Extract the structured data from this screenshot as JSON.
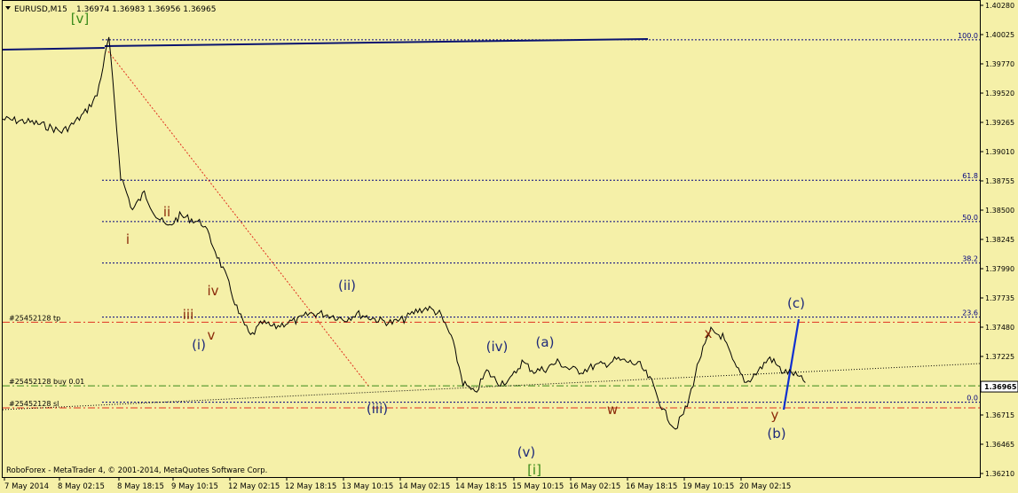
{
  "window": {
    "symbol_header": "EURUSD,M15",
    "ohlc": "1.36974 1.36983 1.36956 1.36965",
    "footer": "RoboForex - MetaTrader 4, © 2001-2014, MetaQuotes Software Corp."
  },
  "colors": {
    "background": "#F5F0A8",
    "price": "#000000",
    "fib": "#000080",
    "wave_navy": "#1F2A7A",
    "wave_red": "#8B2A0A",
    "wave_green": "#3A8A1A",
    "order_red": "#E03020",
    "order_green": "#3A8A1A",
    "trend_red": "#E03020"
  },
  "chart_data": {
    "type": "line",
    "title": "EURUSD,M15",
    "ylim": [
      1.3621,
      1.4028
    ],
    "current_price": "1.36965",
    "y_ticks": [
      "1.40280",
      "1.40025",
      "1.39770",
      "1.39520",
      "1.39265",
      "1.39010",
      "1.38755",
      "1.38500",
      "1.38245",
      "1.37990",
      "1.37735",
      "1.37480",
      "1.37225",
      "1.36965",
      "1.36715",
      "1.36465",
      "1.36210"
    ],
    "x_ticks": [
      "7 May 2014",
      "8 May 02:15",
      "8 May 18:15",
      "9 May 10:15",
      "12 May 02:15",
      "12 May 18:15",
      "13 May 10:15",
      "14 May 02:15",
      "14 May 18:15",
      "15 May 10:15",
      "16 May 02:15",
      "16 May 18:15",
      "19 May 10:15",
      "20 May 02:15"
    ],
    "x_index": [
      0,
      2,
      3,
      4,
      5,
      6,
      7,
      8,
      9,
      10,
      11,
      12,
      13,
      14,
      15,
      16,
      17,
      18,
      19,
      20,
      21,
      22,
      23,
      24,
      25,
      26,
      27,
      28,
      29,
      30,
      31,
      32,
      33,
      34,
      35,
      36,
      37,
      38,
      39,
      40,
      41,
      42,
      43,
      44,
      45,
      46,
      47,
      48,
      49,
      50,
      51,
      52,
      53,
      54,
      55,
      56,
      57,
      58,
      59,
      60,
      61,
      62,
      63,
      64,
      65,
      66,
      67,
      68
    ],
    "price": [
      1.3929,
      1.3927,
      1.3925,
      1.3922,
      1.3918,
      1.3925,
      1.3935,
      1.395,
      1.4,
      1.388,
      1.385,
      1.3865,
      1.3845,
      1.3835,
      1.3845,
      1.3842,
      1.3838,
      1.3815,
      1.379,
      1.376,
      1.374,
      1.3752,
      1.3748,
      1.3752,
      1.3754,
      1.376,
      1.376,
      1.3758,
      1.3755,
      1.376,
      1.3757,
      1.3754,
      1.3752,
      1.3755,
      1.3762,
      1.3765,
      1.376,
      1.374,
      1.37,
      1.369,
      1.371,
      1.37,
      1.3702,
      1.3718,
      1.371,
      1.3712,
      1.3718,
      1.3712,
      1.371,
      1.3714,
      1.3716,
      1.372,
      1.3718,
      1.3715,
      1.37,
      1.3675,
      1.366,
      1.368,
      1.372,
      1.3745,
      1.374,
      1.3715,
      1.37,
      1.371,
      1.3722,
      1.371,
      1.3708,
      1.37
    ],
    "fib_levels": [
      {
        "label": "100.0",
        "price": 1.3998
      },
      {
        "label": "61.8",
        "price": 1.3876
      },
      {
        "label": "50.0",
        "price": 1.384
      },
      {
        "label": "38.2",
        "price": 1.3804
      },
      {
        "label": "23.6",
        "price": 1.3757
      },
      {
        "label": "0.0",
        "price": 1.3683
      }
    ],
    "orders": [
      {
        "label": "#25452128 tp",
        "price": 1.37525,
        "color": "red"
      },
      {
        "label": "#25452128 buy 0.01",
        "price": 1.36972,
        "color": "green"
      },
      {
        "label": "#25452128 sl",
        "price": 1.3678,
        "color": "red"
      }
    ],
    "wave_labels": [
      {
        "text": "[v]",
        "color": "green"
      },
      {
        "text": "i",
        "color": "red"
      },
      {
        "text": "ii",
        "color": "red"
      },
      {
        "text": "iii",
        "color": "red"
      },
      {
        "text": "iv",
        "color": "red"
      },
      {
        "text": "v",
        "color": "red"
      },
      {
        "text": "(i)",
        "color": "navy"
      },
      {
        "text": "(ii)",
        "color": "navy"
      },
      {
        "text": "(iii)",
        "color": "navy"
      },
      {
        "text": "(iv)",
        "color": "navy"
      },
      {
        "text": "(v)",
        "color": "navy"
      },
      {
        "text": "[i]",
        "color": "green"
      },
      {
        "text": "(a)",
        "color": "navy"
      },
      {
        "text": "w",
        "color": "red"
      },
      {
        "text": "x",
        "color": "red"
      },
      {
        "text": "y",
        "color": "red"
      },
      {
        "text": "(b)",
        "color": "navy"
      },
      {
        "text": "(c)",
        "color": "navy"
      }
    ]
  }
}
